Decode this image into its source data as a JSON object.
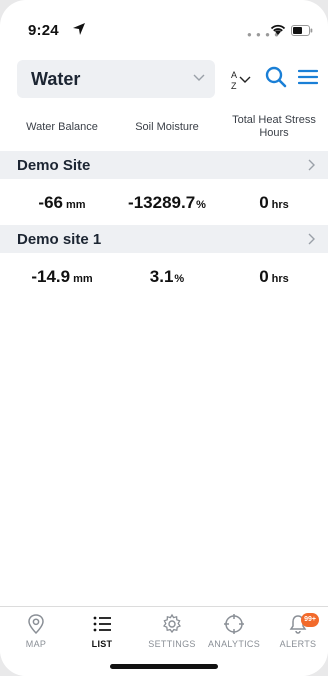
{
  "status_bar": {
    "time": "9:24"
  },
  "header": {
    "selector_value": "Water",
    "sort_label_top": "A",
    "sort_label_bottom": "Z"
  },
  "columns": [
    "Water Balance",
    "Soil Moisture",
    "Total Heat Stress Hours"
  ],
  "sites": [
    {
      "name": "Demo Site",
      "water_balance": "-66",
      "water_balance_unit": "mm",
      "soil_moisture": "-13289.7",
      "soil_moisture_unit": "%",
      "heat_stress": "0",
      "heat_stress_unit": "hrs"
    },
    {
      "name": "Demo site 1",
      "water_balance": "-14.9",
      "water_balance_unit": "mm",
      "soil_moisture": "3.1",
      "soil_moisture_unit": "%",
      "heat_stress": "0",
      "heat_stress_unit": "hrs"
    }
  ],
  "tabs": [
    {
      "label": "MAP",
      "icon": "map-pin-icon"
    },
    {
      "label": "LIST",
      "icon": "list-icon",
      "active": true
    },
    {
      "label": "SETTINGS",
      "icon": "gear-icon"
    },
    {
      "label": "ANALYTICS",
      "icon": "crosshair-icon"
    },
    {
      "label": "ALERTS",
      "icon": "bell-icon",
      "badge": "99+"
    }
  ],
  "colors": {
    "accent": "#1a7fd6",
    "badge": "#f26a2b",
    "row_bg": "#eef0f3"
  }
}
